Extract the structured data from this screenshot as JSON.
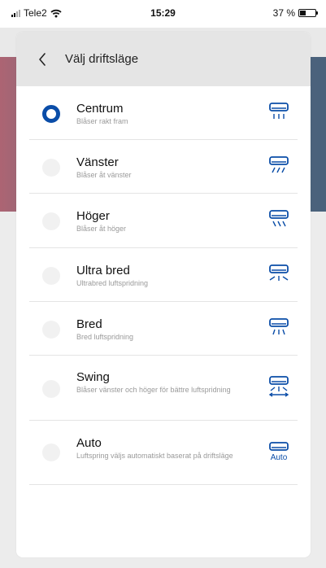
{
  "status_bar": {
    "carrier": "Tele2",
    "time": "15:29",
    "battery_percent": "37 %",
    "battery_level": 0.37
  },
  "header": {
    "back_icon": "chevron-left-icon",
    "title": "Välj driftsläge"
  },
  "colors": {
    "accent": "#0a4da8",
    "radio_unselected": "#f1f1f1",
    "icon": "#0a4da8"
  },
  "modes": [
    {
      "title": "Centrum",
      "subtitle": "Blåser rakt fram",
      "selected": true,
      "icon": "ac-center-icon",
      "icon_label": ""
    },
    {
      "title": "Vänster",
      "subtitle": "Blåser åt vänster",
      "selected": false,
      "icon": "ac-left-icon",
      "icon_label": ""
    },
    {
      "title": "Höger",
      "subtitle": "Blåser åt höger",
      "selected": false,
      "icon": "ac-right-icon",
      "icon_label": ""
    },
    {
      "title": "Ultra bred",
      "subtitle": "Ultrabred luftspridning",
      "selected": false,
      "icon": "ac-ultra-wide-icon",
      "icon_label": ""
    },
    {
      "title": "Bred",
      "subtitle": "Bred luftspridning",
      "selected": false,
      "icon": "ac-wide-icon",
      "icon_label": ""
    },
    {
      "title": "Swing",
      "subtitle": "Blåser vänster och höger för bättre luftspridning",
      "selected": false,
      "icon": "ac-swing-icon",
      "icon_label": ""
    },
    {
      "title": "Auto",
      "subtitle": "Luftspring väljs automatiskt baserat på driftsläge",
      "selected": false,
      "icon": "ac-auto-icon",
      "icon_label": "Auto"
    }
  ]
}
